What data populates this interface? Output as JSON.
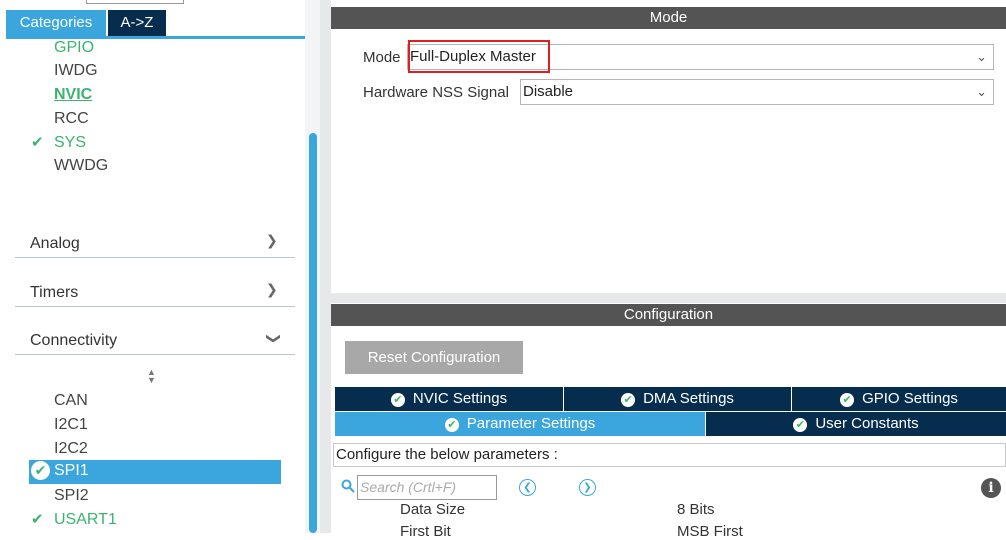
{
  "left_panel": {
    "tabs": {
      "categories": "Categories",
      "az": "A->Z"
    },
    "system_core_items": [
      {
        "label": "GPIO",
        "style": "green"
      },
      {
        "label": "IWDG",
        "style": "normal"
      },
      {
        "label": "NVIC",
        "style": "nvic"
      },
      {
        "label": "RCC",
        "style": "normal"
      },
      {
        "label": "SYS",
        "style": "checked"
      },
      {
        "label": "WWDG",
        "style": "normal"
      }
    ],
    "categories": {
      "analog": "Analog",
      "timers": "Timers",
      "connectivity": "Connectivity"
    },
    "connectivity_items": [
      {
        "label": "CAN",
        "selected": false,
        "checked": false
      },
      {
        "label": "I2C1",
        "selected": false,
        "checked": false
      },
      {
        "label": "I2C2",
        "selected": false,
        "checked": false
      },
      {
        "label": "SPI1",
        "selected": true,
        "checked": true
      },
      {
        "label": "SPI2",
        "selected": false,
        "checked": false
      },
      {
        "label": "USART1",
        "selected": false,
        "checked": true
      }
    ]
  },
  "mode_section": {
    "header": "Mode",
    "mode_label": "Mode",
    "mode_value": "Full-Duplex Master",
    "nss_label": "Hardware NSS Signal",
    "nss_value": "Disable"
  },
  "configuration_section": {
    "header": "Configuration",
    "reset_button": "Reset Configuration",
    "tabs_row1": [
      "NVIC Settings",
      "DMA Settings",
      "GPIO Settings"
    ],
    "tabs_row2": [
      "Parameter Settings",
      "User Constants"
    ],
    "active_tab": "Parameter Settings",
    "description": "Configure the below parameters :",
    "search_placeholder": "Search (Crtl+F)",
    "params": [
      {
        "name": "Data Size",
        "value": "8 Bits"
      },
      {
        "name": "First Bit",
        "value": "MSB First"
      }
    ]
  },
  "colors": {
    "accent_blue": "#3aa6dd",
    "dark_navy": "#062d4e",
    "header_gray": "#545454",
    "ok_green": "#3cb371",
    "highlight_red": "#e02020"
  }
}
